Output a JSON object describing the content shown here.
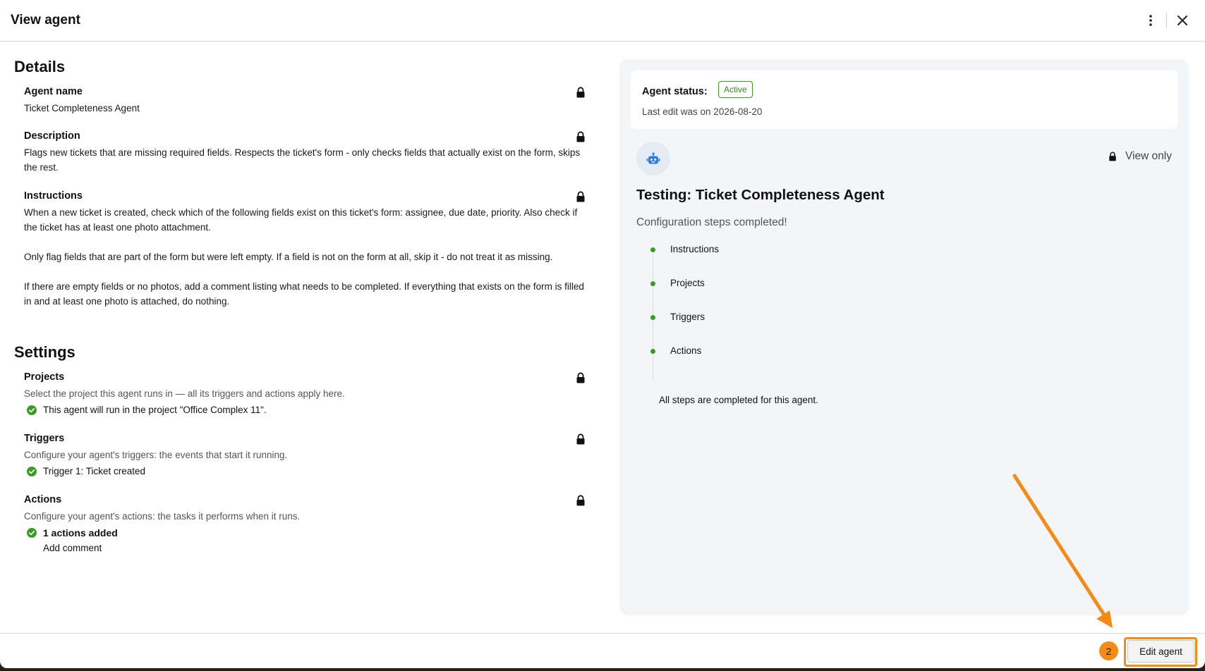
{
  "header": {
    "title": "View agent"
  },
  "details": {
    "section_title": "Details",
    "agent_name": {
      "label": "Agent name",
      "value": "Ticket Completeness Agent"
    },
    "description": {
      "label": "Description",
      "value": "Flags new tickets that are missing required fields. Respects the ticket's form - only checks fields that actually exist on the form, skips the rest."
    },
    "instructions": {
      "label": "Instructions",
      "paragraphs": [
        "When a new ticket is created, check which of the following fields exist on this ticket's form: assignee, due date, priority. Also check if the ticket has at least one photo attachment.",
        "Only flag fields that are part of the form but were left empty. If a field is not on the form at all, skip it - do not treat it as missing.",
        "If there are empty fields or no photos, add a comment listing what needs to be completed. If everything that exists on the form is filled in and at least one photo is attached, do nothing."
      ]
    }
  },
  "settings": {
    "section_title": "Settings",
    "projects": {
      "label": "Projects",
      "help": "Select the project this agent runs in — all its triggers and actions apply here.",
      "status": "This agent will run in the project \"Office Complex 11\"."
    },
    "triggers": {
      "label": "Triggers",
      "help": "Configure your agent's triggers: the events that start it running.",
      "status": "Trigger 1: Ticket created"
    },
    "actions": {
      "label": "Actions",
      "help": "Configure your agent's actions: the tasks it performs when it runs.",
      "status": "1 actions added",
      "items": [
        "Add comment"
      ]
    }
  },
  "status_card": {
    "label": "Agent status:",
    "badge": "Active",
    "last_edit": "Last edit was on 2026-08-20"
  },
  "preview": {
    "view_only": "View only",
    "title": "Testing: Ticket Completeness Agent",
    "subtitle": "Configuration steps completed!",
    "steps": [
      "Instructions",
      "Projects",
      "Triggers",
      "Actions"
    ],
    "all_done": "All steps are completed for this agent."
  },
  "footer": {
    "edit_button": "Edit agent",
    "step_number": "2"
  },
  "icons": {
    "header": [
      "more-vertical-icon",
      "close-icon"
    ],
    "fields": "lock-icon",
    "status": "check-circle-icon",
    "avatar": "robot-icon"
  },
  "colors": {
    "accent_orange": "#f58a14",
    "success_green": "#3d9a27",
    "panel_bg": "#f3f6f9",
    "robot_blue": "#2a7de1"
  }
}
